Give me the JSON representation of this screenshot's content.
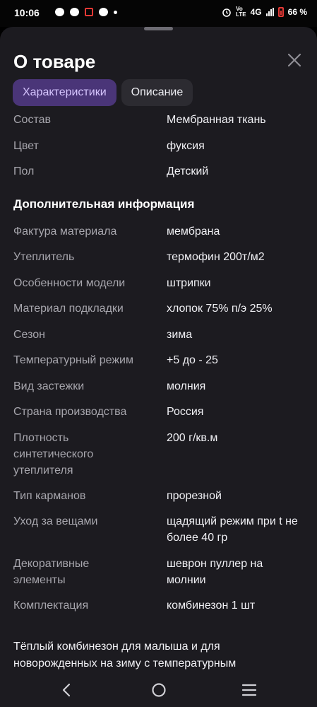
{
  "status_bar": {
    "time": "10:06",
    "network": "4G",
    "battery": "66 %"
  },
  "sheet": {
    "title": "О товаре",
    "close_icon": "close-icon",
    "tabs": [
      {
        "label": "Характеристики",
        "active": true
      },
      {
        "label": "Описание",
        "active": false
      }
    ]
  },
  "top_rows": [
    {
      "label": "Состав",
      "value": "Мембранная ткань"
    },
    {
      "label": "Цвет",
      "value": "фуксия"
    },
    {
      "label": "Пол",
      "value": "Детский"
    }
  ],
  "additional": {
    "heading": "Дополнительная информация",
    "rows": [
      {
        "label": "Фактура материала",
        "value": "мембрана"
      },
      {
        "label": "Утеплитель",
        "value": "термофин 200т/м2"
      },
      {
        "label": "Особенности модели",
        "value": "штрипки"
      },
      {
        "label": "Материал подкладки",
        "value": "хлопок 75% п/э 25%"
      },
      {
        "label": "Сезон",
        "value": "зима"
      },
      {
        "label": "Температурный режим",
        "value": "+5 до - 25"
      },
      {
        "label": "Вид застежки",
        "value": "молния"
      },
      {
        "label": "Страна производства",
        "value": "Россия"
      },
      {
        "label": "Плотность синтетического утеплителя",
        "value": "200 г/кв.м"
      },
      {
        "label": "Тип карманов",
        "value": "прорезной"
      },
      {
        "label": "Уход за вещами",
        "value": "щадящий режим при t не более 40 гр"
      },
      {
        "label": "Декоративные элементы",
        "value": "шеврон пуллер на молнии"
      },
      {
        "label": "Комплектация",
        "value": "комбинезон 1 шт"
      }
    ]
  },
  "description": "Тёплый комбинезон для малыша и для новорожденных на зиму с температурным",
  "nav": {
    "back_icon": "back-icon",
    "home_icon": "home-icon",
    "recents_icon": "recents-icon"
  }
}
